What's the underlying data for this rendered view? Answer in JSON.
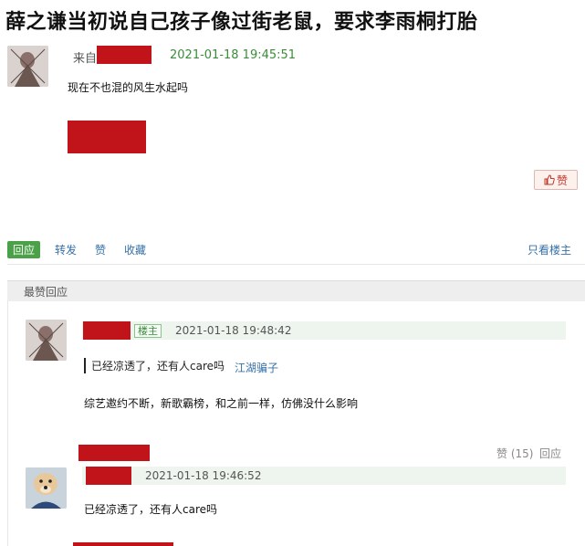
{
  "post": {
    "title": "薛之谦当初说自己孩子像过街老鼠，要求李雨桐打胎",
    "from_label": "来自",
    "timestamp": "2021-01-18 19:45:51",
    "content": "现在不也混的风生水起吗",
    "like_label": "赞"
  },
  "actions": {
    "reply": "回应",
    "forward": "转发",
    "like": "赞",
    "collect": "收藏",
    "only_op": "只看楼主"
  },
  "section": {
    "title": "最赞回应"
  },
  "comments": [
    {
      "badge": "楼主",
      "timestamp": "2021-01-18 19:48:42",
      "quote_text": "已经凉透了，还有人care吗",
      "quote_author": "江湖骗子",
      "content": "综艺邀约不断，新歌霸榜，和之前一样，仿佛没什么影响"
    },
    {
      "likes_label": "赞 (15)",
      "reply_label": "回应",
      "timestamp": "2021-01-18 19:46:52",
      "content": "已经凉透了，还有人care吗"
    }
  ],
  "colors": {
    "accent_green": "#4aa147",
    "link_blue": "#3670a6",
    "redaction": "#c0141a"
  }
}
